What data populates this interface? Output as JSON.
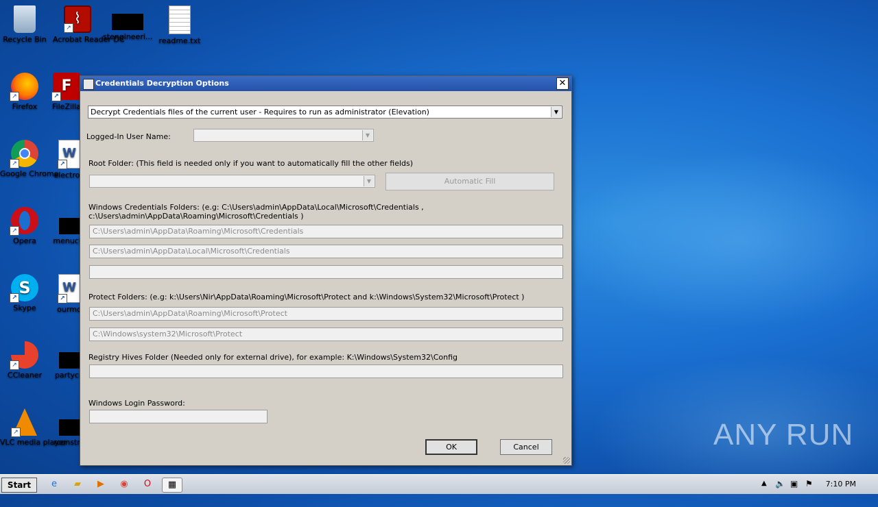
{
  "desktop": {
    "icons": [
      {
        "label": "Recycle Bin"
      },
      {
        "label": "Acrobat Reader DC"
      },
      {
        "label": "stengineeri..."
      },
      {
        "label": "readme.txt"
      },
      {
        "label": "Firefox"
      },
      {
        "label": "FileZilla"
      },
      {
        "label": "Google Chrome"
      },
      {
        "label": "electron"
      },
      {
        "label": "Opera"
      },
      {
        "label": "menucla"
      },
      {
        "label": "Skype"
      },
      {
        "label": "ourmo"
      },
      {
        "label": "CCleaner"
      },
      {
        "label": "partycu"
      },
      {
        "label": "VLC media player"
      },
      {
        "label": "rconstru"
      }
    ]
  },
  "dialog": {
    "title": "Credentials Decryption Options",
    "mode_select": "Decrypt Credentials files of the current user - Requires to run as administrator (Elevation)",
    "logged_in_label": "Logged-In User Name:",
    "root_folder_label": "Root Folder: (This field is needed only if you want to automatically fill the other fields)",
    "automatic_fill": "Automatic Fill",
    "win_cred_label_1": "Windows Credentials Folders:  (e.g: C:\\Users\\admin\\AppData\\Local\\Microsoft\\Credentials ,",
    "win_cred_label_2": "c:\\Users\\admin\\AppData\\Roaming\\Microsoft\\Credentials )",
    "cred_folder_1": "C:\\Users\\admin\\AppData\\Roaming\\Microsoft\\Credentials",
    "cred_folder_2": "C:\\Users\\admin\\AppData\\Local\\Microsoft\\Credentials",
    "cred_folder_3": "",
    "protect_label": "Protect Folders: (e.g: k:\\Users\\Nir\\AppData\\Roaming\\Microsoft\\Protect and k:\\Windows\\System32\\Microsoft\\Protect )",
    "protect_folder_1": "C:\\Users\\admin\\AppData\\Roaming\\Microsoft\\Protect",
    "protect_folder_2": "C:\\Windows\\system32\\Microsoft\\Protect",
    "registry_label": "Registry Hives Folder (Needed only for external drive), for example:  K:\\Windows\\System32\\Config",
    "registry_value": "",
    "password_label": "Windows Login Password:",
    "ok": "OK",
    "cancel": "Cancel"
  },
  "taskbar": {
    "start": "Start",
    "clock": "7:10 PM"
  },
  "watermark": "ANY RUN"
}
